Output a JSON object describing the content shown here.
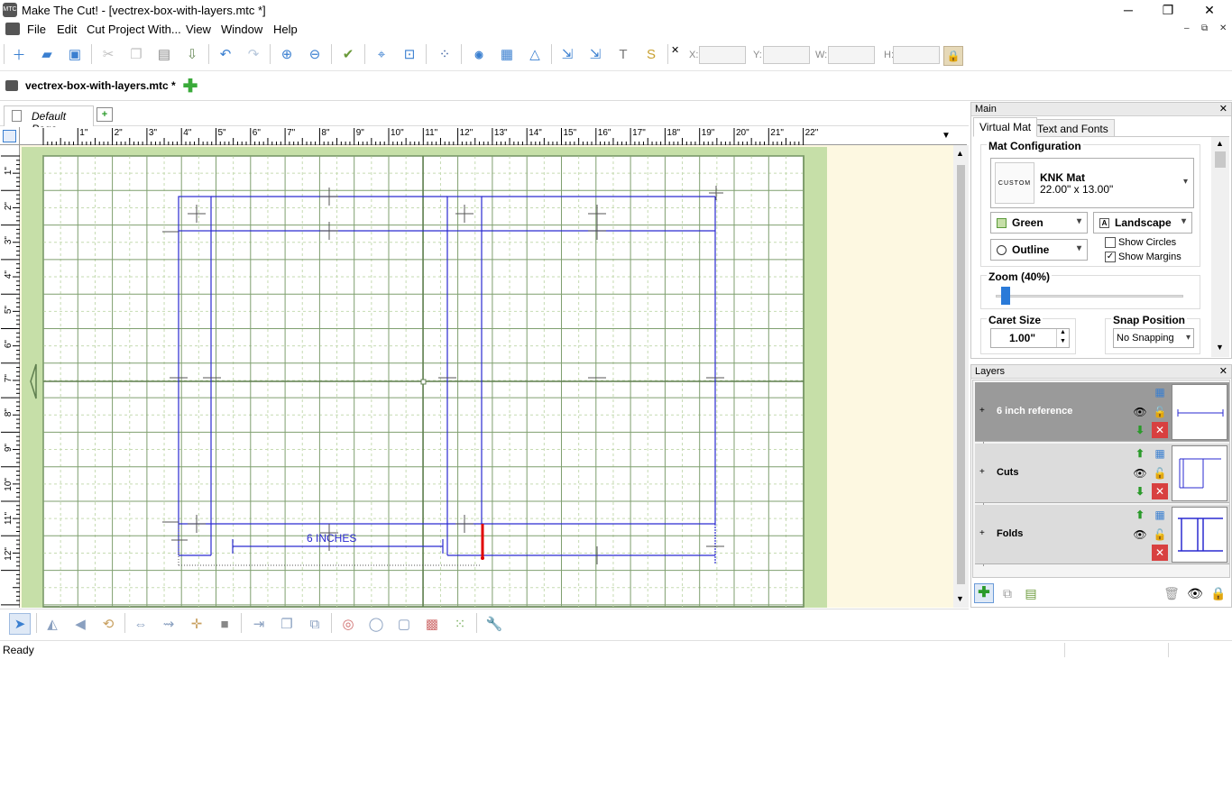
{
  "window": {
    "title": "Make The Cut! - [vectrex-box-with-layers.mtc *]",
    "app_icon_text": "MTC"
  },
  "window_controls": {
    "minimize": "─",
    "restore": "❐",
    "close": "✕"
  },
  "menu": [
    "File",
    "Edit",
    "Cut Project With...",
    "View",
    "Window",
    "Help"
  ],
  "mdi_controls": {
    "minimize": "–",
    "restore": "⧉",
    "close": "✕"
  },
  "toolbar": {
    "coord_labels": {
      "x": "X:",
      "y": "Y:",
      "w": "W:",
      "h": "H:"
    },
    "coord_values": {
      "x": "",
      "y": "",
      "w": "",
      "h": ""
    },
    "icons": [
      "new-icon",
      "open-icon",
      "save-icon",
      "cut-icon",
      "copy-icon",
      "paste-icon",
      "import-icon",
      "undo-icon",
      "redo-icon",
      "zoom-in-icon",
      "zoom-out-icon",
      "checklist-icon",
      "select-all-icon",
      "zoom-fit-icon",
      "points-icon",
      "art-icon",
      "grid-icon",
      "shapes-icon",
      "trace-icon",
      "pixel-trace-icon",
      "text-icon",
      "script-icon"
    ]
  },
  "doc_tab": {
    "label": "vectrex-box-with-layers.mtc *",
    "add": "✚"
  },
  "page_tab": {
    "label": "Default Page"
  },
  "ruler": {
    "h_labels": [
      "1\"",
      "2\"",
      "3\"",
      "4\"",
      "5\"",
      "6\"",
      "7\"",
      "8\"",
      "9\"",
      "10\"",
      "11\"",
      "12\"",
      "13\"",
      "14\"",
      "15\"",
      "16\"",
      "17\"",
      "18\"",
      "19\"",
      "20\"",
      "21\"",
      "22\""
    ],
    "v_labels": [
      "1\"",
      "2\"",
      "3\"",
      "4\"",
      "5\"",
      "6\"",
      "7\"",
      "8\"",
      "9\"",
      "10\"",
      "11\"",
      "12\"",
      "13\""
    ]
  },
  "canvas": {
    "annotation_text": "6 INCHES"
  },
  "status": {
    "text": "Ready"
  },
  "main_panel": {
    "title": "Main",
    "tabs": [
      "Virtual Mat",
      "Text and Fonts"
    ],
    "mat_config": {
      "label": "Mat Configuration",
      "thumb_text": "CUSTOM",
      "name": "KNK Mat",
      "size": "22.00\" x 13.00\""
    },
    "color": "Green",
    "orientation": "Landscape",
    "style": "Outline",
    "show_circles": {
      "label": "Show Circles",
      "checked": false
    },
    "show_margins": {
      "label": "Show Margins",
      "checked": true
    },
    "zoom": {
      "label": "Zoom (40%)",
      "value": 0.03
    },
    "caret_size": {
      "label": "Caret Size",
      "value": "1.00\""
    },
    "snap_position": {
      "label": "Snap Position",
      "value": "No Snapping"
    }
  },
  "layers_panel": {
    "title": "Layers",
    "layers": [
      {
        "name": "6 inch reference",
        "selected": true
      },
      {
        "name": "Cuts",
        "selected": false
      },
      {
        "name": "Folds",
        "selected": false
      }
    ]
  },
  "colors": {
    "mat_green": "#c6dfa8",
    "grid_line": "#5f7f4f",
    "cut_blue": "#2a2ad0",
    "canvas_bg": "#fdf8e1",
    "accent_red": "#e00000"
  }
}
